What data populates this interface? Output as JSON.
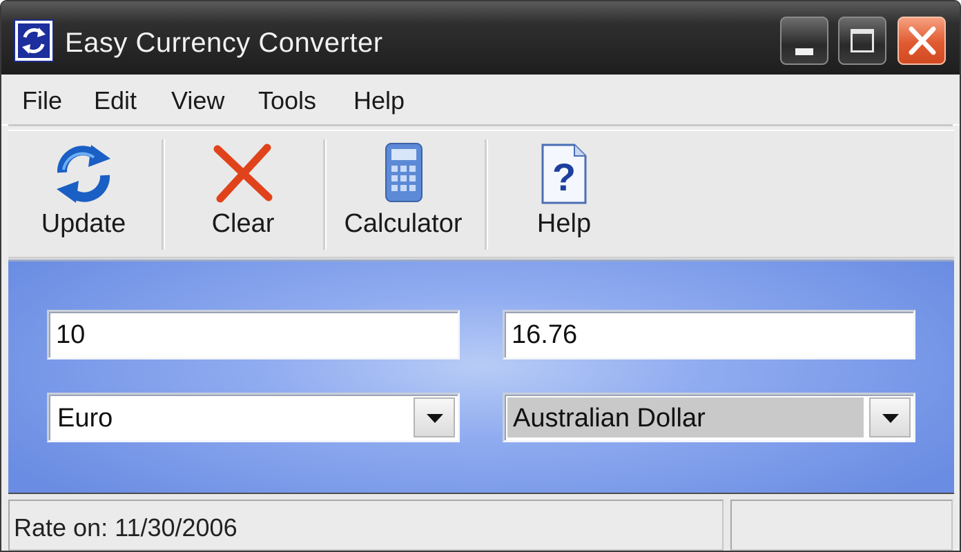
{
  "window": {
    "title": "Easy Currency Converter"
  },
  "menu": {
    "items": [
      "File",
      "Edit",
      "View",
      "Tools",
      "Help"
    ]
  },
  "toolbar": {
    "buttons": [
      {
        "label": "Update",
        "icon": "update-arrows-icon"
      },
      {
        "label": "Clear",
        "icon": "clear-x-icon"
      },
      {
        "label": "Calculator",
        "icon": "calculator-icon"
      },
      {
        "label": "Help",
        "icon": "help-document-icon"
      }
    ]
  },
  "converter": {
    "from_amount": "10",
    "to_amount": "16.76",
    "from_currency": "Euro",
    "to_currency": "Australian Dollar"
  },
  "status": {
    "rate_text": "Rate on:  11/30/2006",
    "secondary": ""
  },
  "colors": {
    "accent_blue": "#8fabf0",
    "close_button": "#e05a30",
    "titlebar": "#1e1e1e"
  }
}
